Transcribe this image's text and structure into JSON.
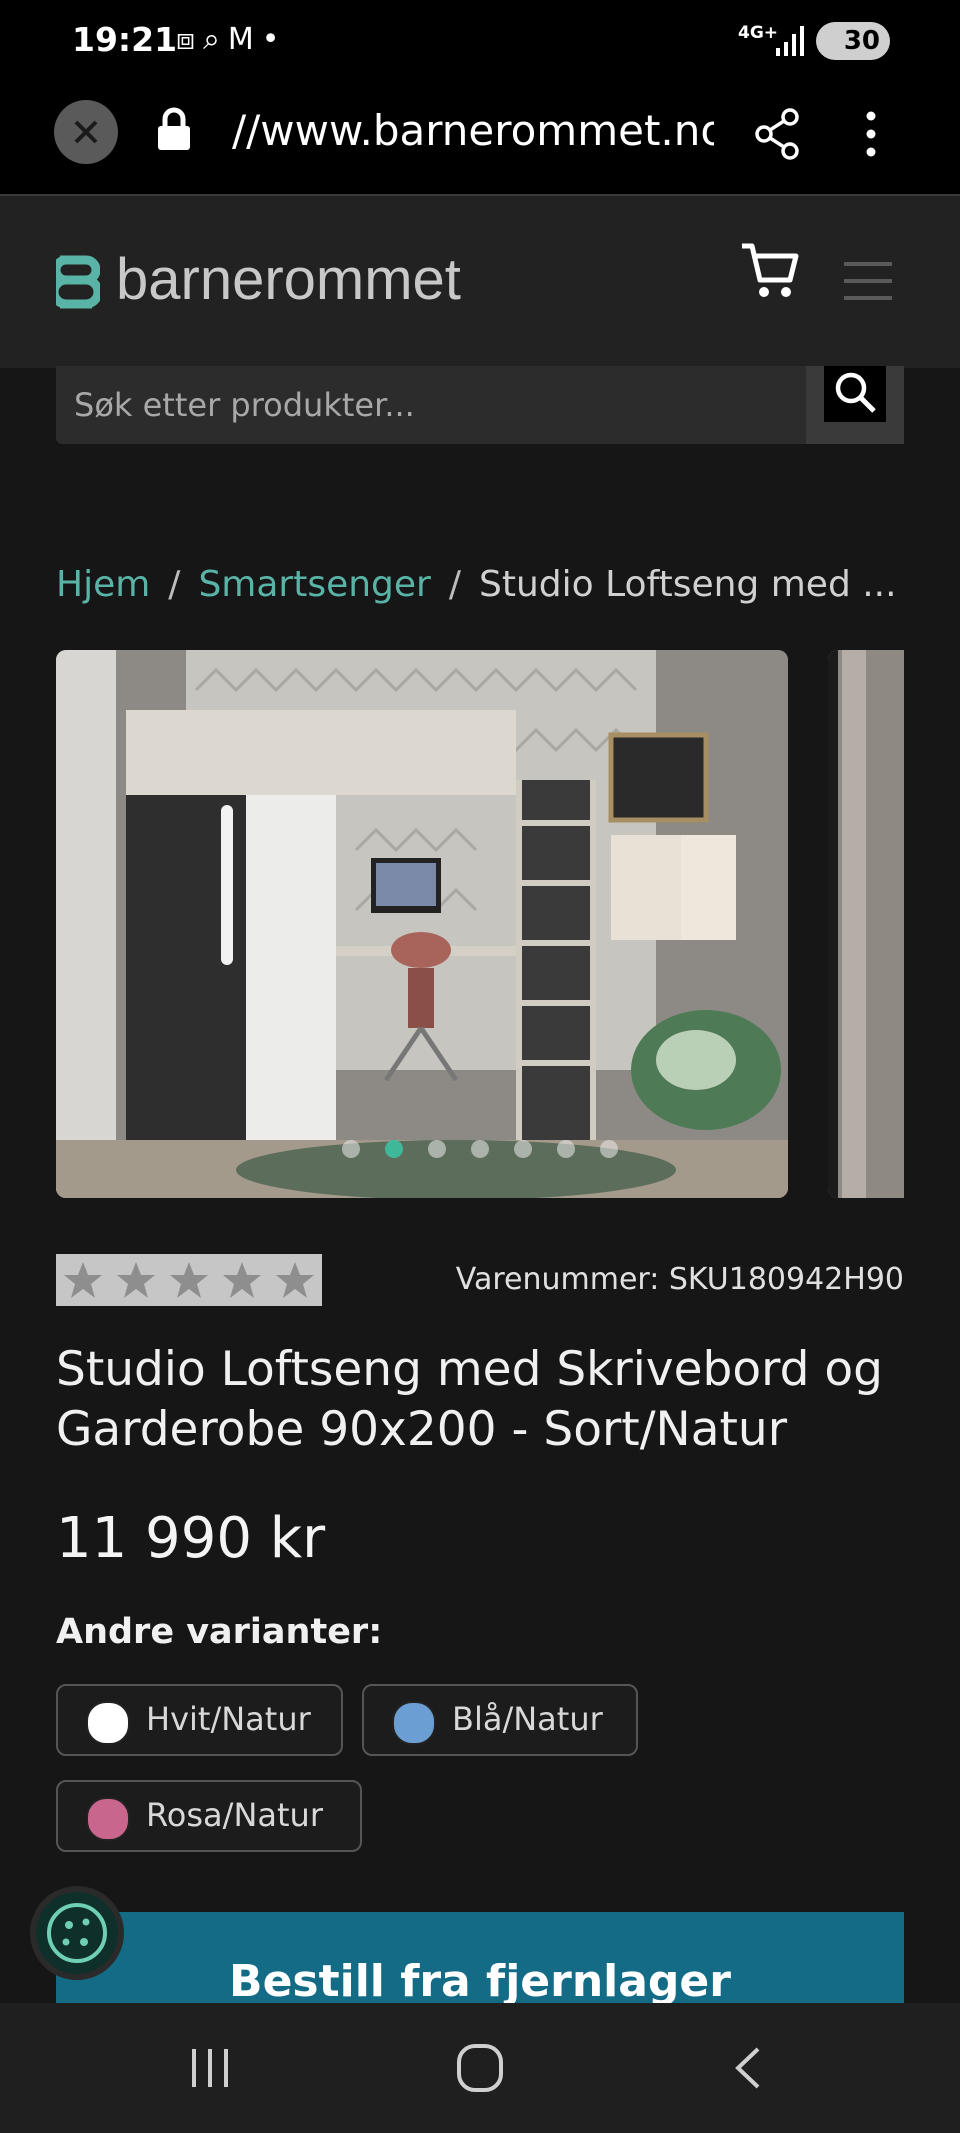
{
  "status_bar": {
    "time": "19:21",
    "network": "4G+",
    "battery": "30"
  },
  "browser": {
    "url": "//www.barnerommet.no/p"
  },
  "site": {
    "logo_text": "barnerommet",
    "brand_color": "#5ab3a7"
  },
  "search": {
    "placeholder": "Søk etter produkter..."
  },
  "breadcrumb": {
    "home": "Hjem",
    "category": "Smartsenger",
    "current": "Studio Loftseng med ..."
  },
  "gallery": {
    "image_count": 7,
    "active_index": 1
  },
  "product": {
    "sku_label": "Varenummer: SKU180942H90",
    "rating_stars": 5,
    "title": "Studio Loftseng med Skrivebord og Garderobe 90x200 - Sort/Natur",
    "price": "11 990 kr",
    "variants_label": "Andre varianter:",
    "variants": [
      {
        "label": "Hvit/Natur",
        "color": "#ffffff"
      },
      {
        "label": "Blå/Natur",
        "color": "#6b9fd4"
      },
      {
        "label": "Rosa/Natur",
        "color": "#c9668e"
      }
    ],
    "order_button": "Bestill fra fjernlager"
  }
}
